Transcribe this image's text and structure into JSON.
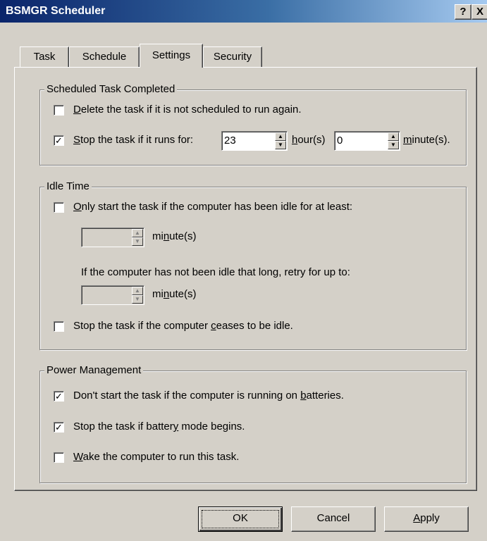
{
  "window": {
    "title": "BSMGR Scheduler",
    "help_button": "?",
    "close_button": "X"
  },
  "tabs": [
    {
      "label": "Task"
    },
    {
      "label": "Schedule"
    },
    {
      "label": "Settings"
    },
    {
      "label": "Security"
    }
  ],
  "scheduled_completed": {
    "title": "Scheduled Task Completed",
    "delete": {
      "prefix": "D",
      "rest": "elete the task if it is not scheduled to run again.",
      "checked": false
    },
    "stop_for": {
      "prefix": "S",
      "rest": "top the task if it runs for:",
      "checked": true
    },
    "hours_value": "23",
    "hours_label_u": "h",
    "hours_label_rest": "our(s)",
    "minutes_value": "0",
    "minutes_label_u": "m",
    "minutes_label_rest": "inute(s)."
  },
  "idle_time": {
    "title": "Idle Time",
    "only_start": {
      "prefix": "O",
      "rest": "nly start the task if the computer has been idle for at least:",
      "checked": false
    },
    "minutes1_a": "mi",
    "minutes1_u": "n",
    "minutes1_b": "ute(s)",
    "retry_text": "If the computer has not been idle that long, retry for up to:",
    "minutes2_a": "mi",
    "minutes2_u": "n",
    "minutes2_b": "ute(s)",
    "stop_idle": {
      "a": "Stop the task if the computer ",
      "u": "c",
      "b": "eases to be idle.",
      "checked": false
    }
  },
  "power": {
    "title": "Power Management",
    "dont_start": {
      "a": "Don't start the task if the computer is running on ",
      "u": "b",
      "b": "atteries.",
      "checked": true
    },
    "stop_battery": {
      "a": "Stop the task if batter",
      "u": "y",
      "b": " mode begins.",
      "checked": true
    },
    "wake": {
      "u": "W",
      "b": "ake the computer to run this task.",
      "checked": false
    }
  },
  "buttons": {
    "ok": "OK",
    "cancel": "Cancel",
    "apply_u": "A",
    "apply_rest": "pply"
  },
  "colors": {
    "titlebar_start": "#0a246a",
    "titlebar_end": "#a6caf0",
    "face": "#d4d0c8"
  }
}
